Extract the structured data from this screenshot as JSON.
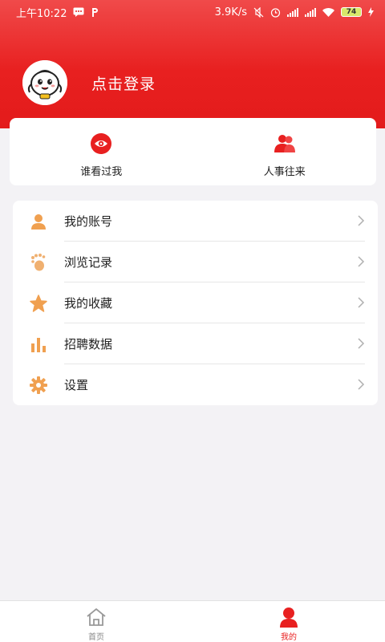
{
  "status_bar": {
    "time": "上午10:22",
    "net_speed": "3.9K/s",
    "battery": "74"
  },
  "profile": {
    "login_text": "点击登录"
  },
  "quick": [
    {
      "label": "谁看过我",
      "icon": "eye-icon"
    },
    {
      "label": "人事往来",
      "icon": "people-icon"
    }
  ],
  "menu": [
    {
      "label": "我的账号",
      "icon": "user-icon"
    },
    {
      "label": "浏览记录",
      "icon": "footprint-icon"
    },
    {
      "label": "我的收藏",
      "icon": "star-icon"
    },
    {
      "label": "招聘数据",
      "icon": "bar-chart-icon"
    },
    {
      "label": "设置",
      "icon": "gear-icon"
    }
  ],
  "bottom_nav": [
    {
      "label": "首页",
      "icon": "home-icon",
      "active": false
    },
    {
      "label": "我的",
      "icon": "profile-icon",
      "active": true
    }
  ],
  "colors": {
    "brand_red": "#e82020",
    "menu_icon_orange": "#f0a050",
    "text_dark": "#222222"
  }
}
